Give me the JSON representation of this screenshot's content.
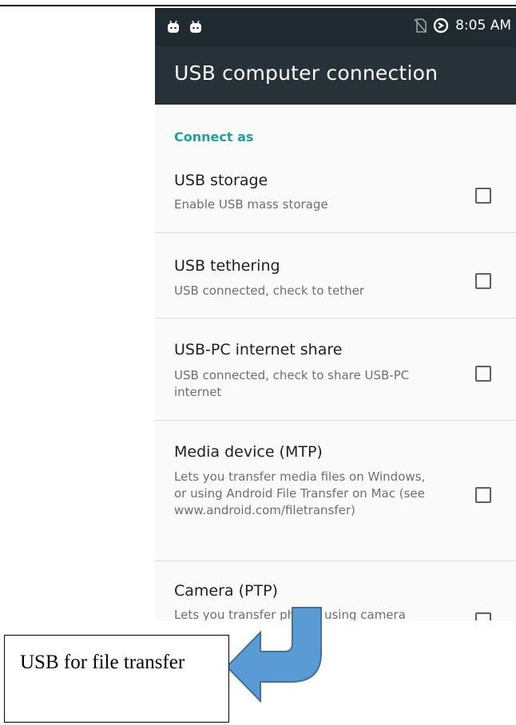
{
  "status_bar": {
    "left_icons": [
      "android-debug-icon",
      "android-debug-icon"
    ],
    "right_icons": [
      "no-sim-icon",
      "data-saver-icon"
    ],
    "time": "8:05 AM"
  },
  "app_bar": {
    "title": "USB computer connection"
  },
  "section": {
    "header": "Connect as"
  },
  "options": [
    {
      "title": "USB storage",
      "subtitle": "Enable USB mass storage",
      "checked": false
    },
    {
      "title": "USB tethering",
      "subtitle": "USB connected, check to tether",
      "checked": false
    },
    {
      "title": "USB-PC internet share",
      "subtitle": "USB connected, check to share USB-PC internet",
      "checked": false
    },
    {
      "title": "Media device (MTP)",
      "subtitle": "Lets you transfer media files on Windows, or using Android File Transfer on Mac (see www.android.com/filetransfer)",
      "checked": false
    },
    {
      "title": "Camera (PTP)",
      "subtitle": "Lets you transfer photos using camera",
      "checked": false
    }
  ],
  "annotation": {
    "text": "USB for file transfer",
    "arrow_color": "#5b9bd5",
    "arrow_icon": "curved-arrow-icon"
  },
  "colors": {
    "status_bar": "#1f2b30",
    "app_bar": "#263238",
    "accent": "#1aa49a"
  }
}
